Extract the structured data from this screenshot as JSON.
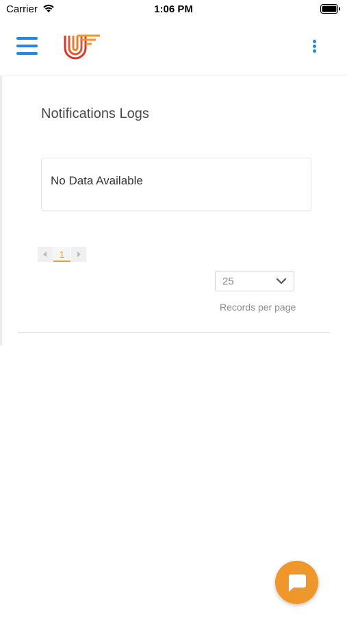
{
  "status_bar": {
    "carrier": "Carrier",
    "time": "1:06 PM"
  },
  "header": {
    "menu_icon": "hamburger-menu-icon",
    "logo_icon": "brand-logo",
    "more_icon": "kebab-menu-icon"
  },
  "main": {
    "title": "Notifications Logs",
    "empty_message": "No Data Available",
    "pagination": {
      "current_page": "1"
    },
    "records_per_page": {
      "value": "25",
      "label": "Records per page"
    }
  },
  "chat": {
    "icon": "chat-bubble-icon"
  },
  "colors": {
    "accent_blue": "#2288e3",
    "accent_orange": "#f0972c",
    "page_active": "#e8a132",
    "logo_red": "#d9362a",
    "logo_orange": "#f0952c"
  }
}
